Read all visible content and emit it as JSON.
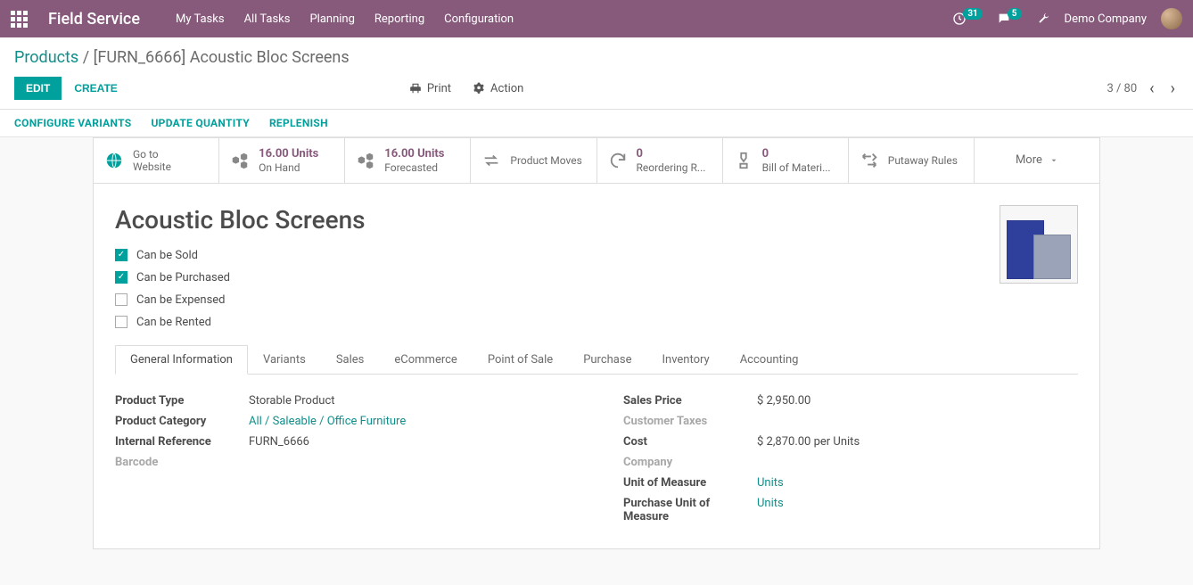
{
  "topbar": {
    "brand": "Field Service",
    "nav": [
      "My Tasks",
      "All Tasks",
      "Planning",
      "Reporting",
      "Configuration"
    ],
    "activity_count": "31",
    "chat_count": "5",
    "company": "Demo Company"
  },
  "breadcrumb": {
    "parent": "Products",
    "current": "[FURN_6666] Acoustic Bloc Screens"
  },
  "actions": {
    "edit": "EDIT",
    "create": "CREATE",
    "print": "Print",
    "action": "Action",
    "pager": "3 / 80"
  },
  "subbar": [
    "CONFIGURE VARIANTS",
    "UPDATE QUANTITY",
    "REPLENISH"
  ],
  "stats": {
    "website": {
      "l1": "Go to",
      "l2": "Website"
    },
    "onhand": {
      "num": "16.00 Units",
      "txt": "On Hand"
    },
    "forecast": {
      "num": "16.00 Units",
      "txt": "Forecasted"
    },
    "moves": {
      "txt": "Product Moves"
    },
    "reorder": {
      "num": "0",
      "txt": "Reordering R..."
    },
    "bom": {
      "num": "0",
      "txt": "Bill of Materi..."
    },
    "putaway": {
      "txt": "Putaway Rules"
    },
    "more": "More"
  },
  "product": {
    "title": "Acoustic Bloc Screens",
    "checks": {
      "sold": {
        "label": "Can be Sold",
        "checked": true
      },
      "purchased": {
        "label": "Can be Purchased",
        "checked": true
      },
      "expensed": {
        "label": "Can be Expensed",
        "checked": false
      },
      "rented": {
        "label": "Can be Rented",
        "checked": false
      }
    }
  },
  "tabs": [
    "General Information",
    "Variants",
    "Sales",
    "eCommerce",
    "Point of Sale",
    "Purchase",
    "Inventory",
    "Accounting"
  ],
  "general": {
    "left": {
      "product_type": {
        "label": "Product Type",
        "value": "Storable Product"
      },
      "category": {
        "label": "Product Category",
        "value": "All / Saleable / Office Furniture"
      },
      "internal_ref": {
        "label": "Internal Reference",
        "value": "FURN_6666"
      },
      "barcode": {
        "label": "Barcode",
        "value": ""
      }
    },
    "right": {
      "sales_price": {
        "label": "Sales Price",
        "value": "$ 2,950.00"
      },
      "customer_taxes": {
        "label": "Customer Taxes",
        "value": ""
      },
      "cost": {
        "label": "Cost",
        "value": "$ 2,870.00",
        "suffix": "per Units"
      },
      "company": {
        "label": "Company",
        "value": ""
      },
      "uom": {
        "label": "Unit of Measure",
        "value": "Units"
      },
      "puom": {
        "label": "Purchase Unit of Measure",
        "value": "Units"
      }
    }
  }
}
